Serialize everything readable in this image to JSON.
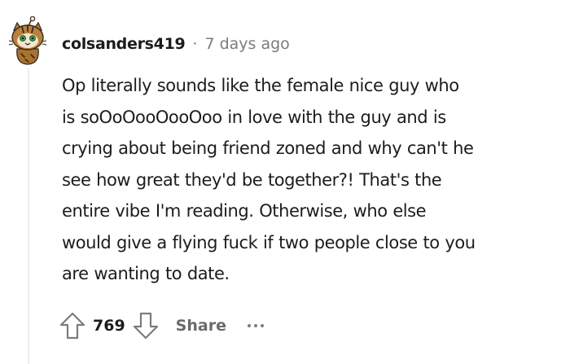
{
  "comment": {
    "username": "colsanders419",
    "separator": "·",
    "timestamp": "7 days ago",
    "body_lines": [
      "Op literally sounds like the female nice guy who",
      "is soOoOooOooOoo in love with the guy and is",
      "crying about being friend zoned and why can't he",
      "see how great they'd be together?! That's the",
      "entire vibe I'm reading. Otherwise, who else",
      "would give a flying fuck if two people close to you",
      "are wanting to date."
    ],
    "actions": {
      "upvote_icon": "arrow-up-outline-icon",
      "score": "769",
      "downvote_icon": "arrow-down-outline-icon",
      "share_label": "Share",
      "more_icon": "ellipsis-icon"
    },
    "avatar_icon": "snoo-avatar-icon"
  }
}
